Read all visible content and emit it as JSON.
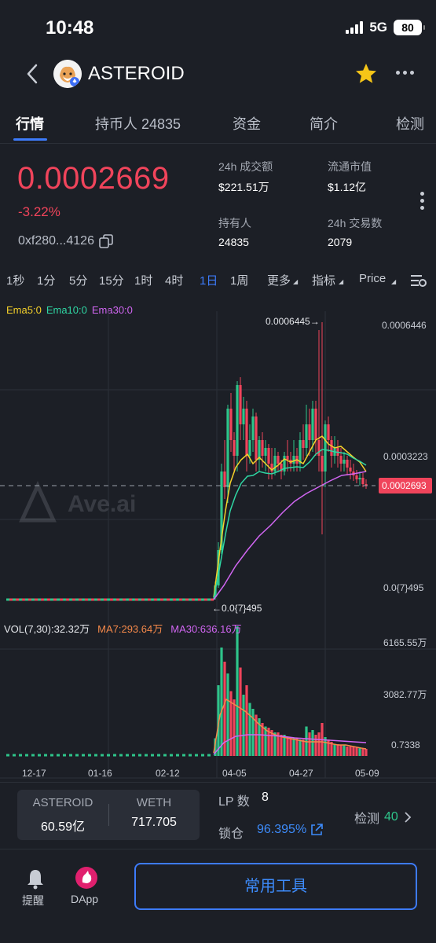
{
  "status": {
    "time": "10:48",
    "network": "5G",
    "battery": "80"
  },
  "header": {
    "title": "ASTEROID"
  },
  "tabs": [
    {
      "label": "行情"
    },
    {
      "label": "持币人 24835"
    },
    {
      "label": "资金"
    },
    {
      "label": "简介"
    },
    {
      "label": "检测"
    }
  ],
  "summary": {
    "price": "0.0002669",
    "change": "-3.22%",
    "address": "0xf280...4126",
    "stats": [
      {
        "label": "24h 成交额",
        "value": "$221.51万"
      },
      {
        "label": "流通市值",
        "value": "$1.12亿"
      },
      {
        "label": "持有人",
        "value": "24835"
      },
      {
        "label": "24h 交易数",
        "value": "2079"
      }
    ]
  },
  "intervals": [
    "1秒",
    "1分",
    "5分",
    "15分",
    "1时",
    "4时",
    "1日",
    "1周",
    "更多",
    "指标",
    "Price"
  ],
  "selected_interval": "1日",
  "ema_legend": {
    "ema5": "Ema5:0",
    "ema10": "Ema10:0",
    "ema30": "Ema30:0"
  },
  "vol_legend": {
    "vol": "VOL(7,30):32.32万",
    "ma7": "MA7:293.64万",
    "ma30": "MA30:636.16万"
  },
  "colors": {
    "up": "#2ec48a",
    "down": "#f0445b",
    "ema5": "#f5d12a",
    "ema10": "#2fd7a4",
    "ema30": "#d166f2",
    "accent": "#3d7bfa"
  },
  "chart_data": {
    "type": "candlestick",
    "watermark": "Ave.ai",
    "price_axis": [
      "0.0006446",
      "0.0003223",
      "0.0{7}495"
    ],
    "current_price_label": "0.0002693",
    "high_annotation": "0.0006445→",
    "low_annotation": "←0.0{7}495",
    "volume_axis": [
      "6165.55万",
      "3082.77万",
      "0.7338"
    ],
    "x_ticks": [
      "12-17",
      "01-16",
      "02-12",
      "04-05",
      "04-27",
      "05-09"
    ]
  },
  "pool": {
    "token_a": {
      "name": "ASTEROID",
      "value": "60.59亿"
    },
    "token_b": {
      "name": "WETH",
      "value": "717.705"
    },
    "lp_label": "LP 数",
    "lp_value": "8",
    "lock_label": "锁仓",
    "lock_value": "96.395%",
    "detect_label": "检测",
    "detect_value": "40"
  },
  "bottom_bar": {
    "remind": "提醒",
    "dapp": "DApp",
    "tools": "常用工具"
  }
}
